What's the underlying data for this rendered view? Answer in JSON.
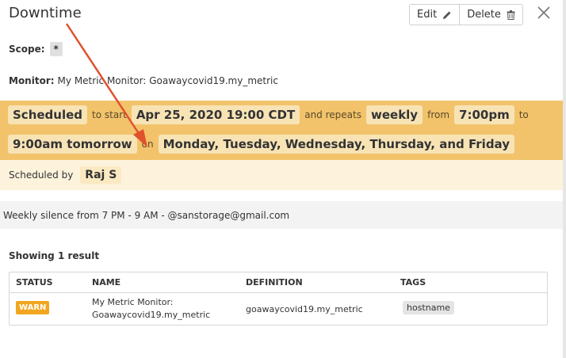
{
  "header": {
    "title": "Downtime",
    "edit_label": "Edit",
    "delete_label": "Delete"
  },
  "scope": {
    "label": "Scope:",
    "value": "*"
  },
  "monitor": {
    "label": "Monitor:",
    "value": "My Metric Monitor: Goawaycovid19.my_metric"
  },
  "schedule": {
    "status": "Scheduled",
    "to_start_text": "to start",
    "start": "Apr 25, 2020 19:00 CDT",
    "repeats_text": "and repeats",
    "frequency": "weekly",
    "from_text": "from",
    "from_time": "7:00pm",
    "to_text": "to",
    "to_time": "9:00am tomorrow",
    "on_text": "on",
    "days": "Monday, Tuesday, Wednesday, Thursday, and Friday",
    "by_label": "Scheduled by",
    "by_user": "Raj S"
  },
  "message": "Weekly silence from 7 PM - 9 AM - @sanstorage@gmail.com",
  "results": {
    "summary": "Showing 1 result",
    "columns": [
      "STATUS",
      "NAME",
      "DEFINITION",
      "TAGS"
    ],
    "rows": [
      {
        "status": "WARN",
        "name_line1": "My Metric Monitor:",
        "name_line2": "Goawaycovid19.my_metric",
        "definition": "goawaycovid19.my_metric",
        "tag": "hostname"
      }
    ]
  },
  "colors": {
    "schedule_bg": "#f2c36b",
    "chip_bg": "#f8e3b5",
    "warn": "#f2a620",
    "annotation_arrow": "#e0522e"
  },
  "icons": [
    "pencil-icon",
    "trash-icon",
    "close-icon"
  ]
}
